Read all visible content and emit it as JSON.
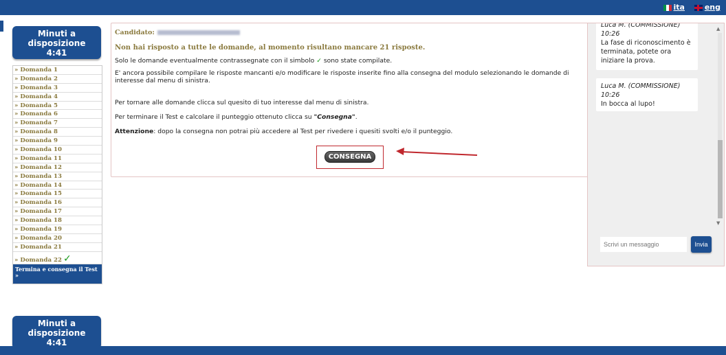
{
  "header": {
    "languages": [
      {
        "code": "ita",
        "flag": "italian-flag-icon"
      },
      {
        "code": "eng",
        "flag": "uk-flag-icon"
      }
    ]
  },
  "timer": {
    "label": "Minuti a disposizione",
    "value": "4:41"
  },
  "nav": {
    "items": [
      "» Domanda 1",
      "» Domanda 2",
      "» Domanda 3",
      "» Domanda 4",
      "» Domanda 5",
      "» Domanda 6",
      "» Domanda 7",
      "» Domanda 8",
      "» Domanda 9",
      "» Domanda 10",
      "» Domanda 11",
      "» Domanda 12",
      "» Domanda 13",
      "» Domanda 14",
      "» Domanda 15",
      "» Domanda 16",
      "» Domanda 17",
      "» Domanda 18",
      "» Domanda 19",
      "» Domanda 20",
      "» Domanda 21"
    ],
    "last_item": "» Domanda 22",
    "last_item_check": "✓",
    "end_label_1": "Termina e consegna il Test",
    "end_label_2": "»"
  },
  "main": {
    "candidate_label": "Candidato:",
    "warning": "Non hai risposto a tutte le domande, al momento risultano mancare 21 risposte.",
    "line1_a": "Solo le domande eventualmente contrassegnate con il simbolo",
    "line1_check": "✓",
    "line1_b": "sono state compilate.",
    "line2": "E' ancora possibile compilare le risposte mancanti e/o modificare le risposte inserite fino alla consegna del modulo selezionando le domande di interesse dal menu di sinistra.",
    "line3": "Per tornare alle domande clicca sul quesito di tuo interesse dal menu di sinistra.",
    "line4_a": "Per terminare il Test e calcolare il punteggio ottenuto clicca su",
    "line4_b": "\"Consegna\"",
    "line4_c": ".",
    "line5_a": "Attenzione",
    "line5_b": ": dopo la consegna non potrai più accedere al Test per rivedere i quesiti svolti e/o il punteggio.",
    "button": "CONSEGNA"
  },
  "chat": {
    "messages": [
      {
        "who": "Luca M. (COMMISSIONE)",
        "time": "10:26",
        "text": "La fase di riconoscimento è terminata, potete ora iniziare la prova."
      },
      {
        "who": "Luca M. (COMMISSIONE)",
        "time": "10:26",
        "text": "In bocca al lupo!"
      }
    ],
    "input_placeholder": "Scrivi un messaggio",
    "send_label": "Invia"
  },
  "colors": {
    "brand": "#1d4f91",
    "accent_text": "#8a7a3e",
    "check": "#1a9a1a",
    "highlight": "#c0272d"
  }
}
